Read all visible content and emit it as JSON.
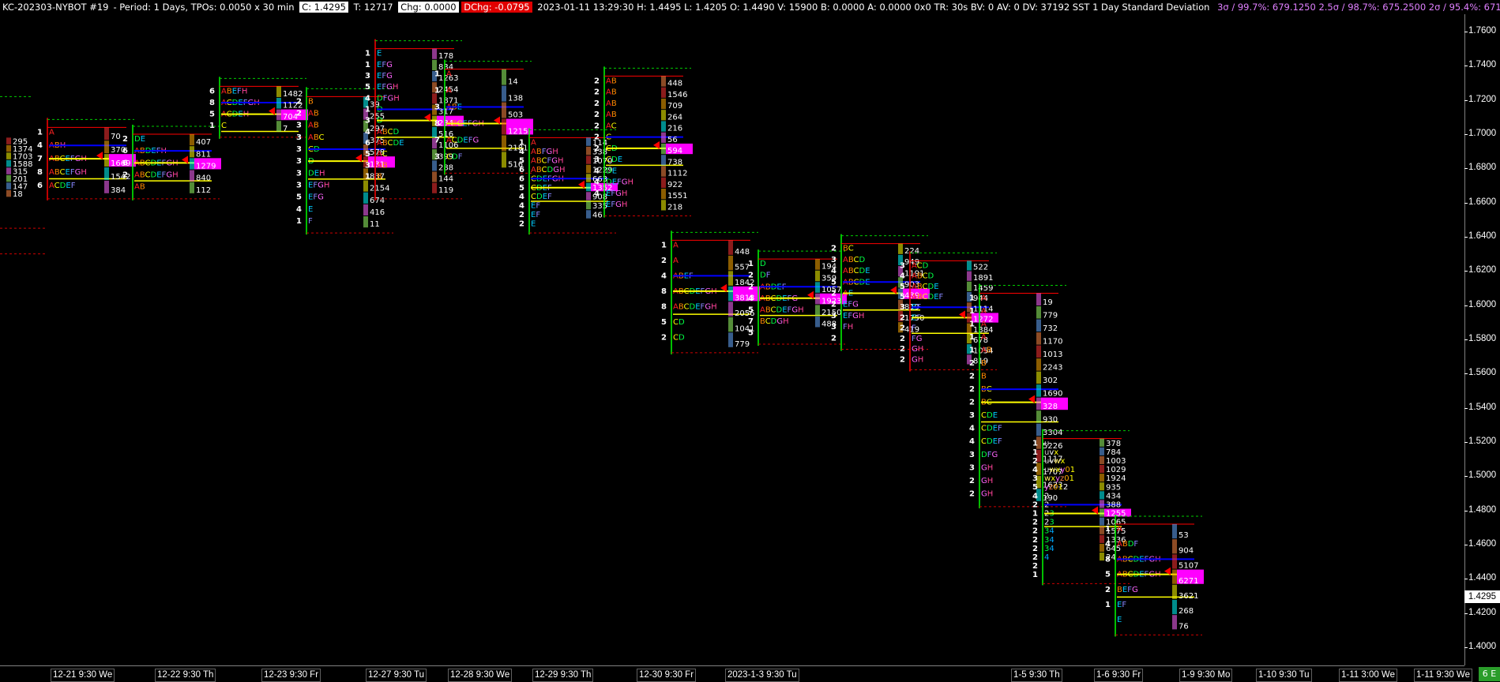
{
  "header": {
    "symbol": "KC-202303-NYBOT  #19",
    "period": "- Period: 1 Days, TPOs: 0.0050 x 30 min",
    "close": "C: 1.4295",
    "ticks": "T: 12717",
    "change": "Chg: 0.0000",
    "dchange": "DChg: -0.0795",
    "stats": "2023-01-11 13:29:30 H: 1.4495 L: 1.4205 O: 1.4490 V: 15900 B: 0.0000 A: 0.0000 0x0 TR: 30s BV: 0 AV: 0 DV: 37192 SST 1 Day Standard Deviation",
    "sd": "3σ / 99.7%: 679.1250  2.5σ / 98.7%: 675.2500  2σ / 95.4%: 671.3750  1.618σ /"
  },
  "colors": {
    "background": "#000000",
    "poc": "#ffff00",
    "va_line": "#0000ff",
    "magenta": "#ff00ff",
    "up_open": "#00ff00",
    "down_close": "#ff0000",
    "range_dash": "#00cc00",
    "low_dash": "#cc0000"
  },
  "yaxis": {
    "ticks": [
      "1.7600",
      "1.7400",
      "1.7200",
      "1.7000",
      "1.6800",
      "1.6600",
      "1.6400",
      "1.6200",
      "1.6000",
      "1.5800",
      "1.5600",
      "1.5400",
      "1.5200",
      "1.5000",
      "1.4800",
      "1.4600",
      "1.4400",
      "1.4200",
      "1.4000"
    ],
    "current_price": "1.4295"
  },
  "sessions": [
    {
      "date": "12-21  9:30 We",
      "high": 1.704,
      "low": 1.665,
      "up": false,
      "counts": [
        "1",
        "4",
        "7",
        "8",
        "6"
      ],
      "letters": [
        "A",
        "ABH",
        "ABCEFGH",
        "ABCEFGH",
        "ACDEF"
      ],
      "volumes": [
        "70",
        "370",
        "1669",
        "1542",
        "384"
      ],
      "volbars": [
        "295",
        "1374",
        "1703",
        "1588",
        "315",
        "201",
        "147",
        "18"
      ]
    },
    {
      "date": "12-22  9:30 Th",
      "high": 1.7,
      "low": 1.665,
      "up": true,
      "counts": [
        "2",
        "6",
        "6",
        "2"
      ],
      "letters": [
        "DE",
        "ABDEFH",
        "ABCDEFGH",
        "ABCDEFGH",
        "AB"
      ],
      "volumes": [
        "407",
        "811",
        "1279",
        "840",
        "112"
      ]
    },
    {
      "date": "12-23  9:30 Fr",
      "high": 1.728,
      "low": 1.701,
      "up": true,
      "counts": [
        "6",
        "8",
        "5",
        "1"
      ],
      "letters": [
        "ABEFH",
        "ACDEFGH",
        "ACDEH",
        "C"
      ],
      "volumes": [
        "1482",
        "1122",
        "704",
        "7"
      ]
    },
    {
      "date": "12-27  9:30 Tu",
      "high": 1.722,
      "low": 1.645,
      "up": true,
      "counts": [
        "2",
        "2",
        "3",
        "3",
        "3",
        "3",
        "3",
        "3",
        "5",
        "4",
        "1"
      ],
      "letters": [
        "B",
        "AB",
        "AB",
        "ABC",
        "CD",
        "D",
        "DEH",
        "EFGH",
        "EFG",
        "E",
        "F"
      ],
      "volumes": [
        "39",
        "255",
        "297",
        "375",
        "578",
        "131",
        "837",
        "2154",
        "674",
        "416",
        "11"
      ]
    },
    {
      "date": "12-28  9:30 We",
      "high": 1.75,
      "low": 1.665,
      "up": false,
      "counts": [
        "1",
        "1",
        "3",
        "5",
        "4",
        "1",
        "3",
        "4",
        "6",
        "5",
        "3",
        "1"
      ],
      "letters": [
        "E",
        "EFG",
        "EFG",
        "EFGH",
        "DFGH",
        "D",
        "D",
        "ABCD",
        "ABCDE",
        "AC",
        "AB",
        "B"
      ],
      "volumes": [
        "178",
        "834",
        "1263",
        "2454",
        "1871",
        "317",
        "234",
        "516",
        "1106",
        "399",
        "288",
        "144",
        "119"
      ]
    },
    {
      "date": "12-29  9:30 Th",
      "high": 1.738,
      "low": 1.68,
      "up": true,
      "counts": [
        "1",
        "1",
        "3",
        "8",
        "7",
        "3"
      ],
      "letters": [
        "A",
        "A",
        "ABE",
        "ABCEFGH",
        "ACDEFG",
        "CDF"
      ],
      "volumes": [
        "14",
        "138",
        "503",
        "1215",
        "2181",
        "516"
      ]
    },
    {
      "date": "12-30  9:30 Fr",
      "high": 1.698,
      "low": 1.645,
      "up": true,
      "counts": [
        "1",
        "4",
        "5",
        "6",
        "6",
        "5",
        "4",
        "4",
        "2",
        "2"
      ],
      "letters": [
        "A",
        "ABFGH",
        "ABCFGH",
        "ABCDGH",
        "CDEFGH",
        "CDEF",
        "CDEF",
        "EF",
        "EF",
        "E"
      ],
      "volumes": [
        "114",
        "338",
        "1070",
        "1229",
        "663",
        "1352",
        "908",
        "335",
        "46"
      ]
    },
    {
      "date": "2023-1-3  9:30 Tu",
      "high": 1.734,
      "low": 1.655,
      "up": true,
      "counts": [
        "2",
        "2",
        "2",
        "2",
        "2",
        "2",
        "2",
        "3",
        "4",
        "4",
        "4"
      ],
      "letters": [
        "AB",
        "AB",
        "AB",
        "AB",
        "AC",
        "C",
        "CD",
        "CDE",
        "DE",
        "DEFGH",
        "EFGH",
        "EFGH"
      ],
      "volumes": [
        "448",
        "1546",
        "709",
        "264",
        "216",
        "56",
        "594",
        "738",
        "1112",
        "922",
        "1551",
        "218"
      ]
    },
    {
      "date": "",
      "high": 1.638,
      "low": 1.575,
      "up": true,
      "counts": [
        "1",
        "2",
        "4",
        "8",
        "8",
        "5",
        "2"
      ],
      "letters": [
        "A",
        "A",
        "ABEF",
        "ABCDEFGH",
        "ABCDEFGH",
        "CD",
        "CD"
      ],
      "volumes": [
        "448",
        "557",
        "1842",
        "3813",
        "2056",
        "1041",
        "779"
      ]
    },
    {
      "date": "1-5  9:30 Th",
      "high": 1.627,
      "low": 1.58,
      "up": true,
      "counts": [
        "1",
        "2",
        "2",
        "4",
        "5",
        "7",
        "5"
      ],
      "letters": [
        "D",
        "DF",
        "ABDEF",
        "ABCDEFG",
        "ABCDEFGH",
        "BCDGH"
      ],
      "volumes": [
        "194",
        "359",
        "1057",
        "1923",
        "2150",
        "488"
      ]
    },
    {
      "date": "1-6  9:30 Fr",
      "high": 1.636,
      "low": 1.577,
      "up": true,
      "counts": [
        "2",
        "3",
        "4",
        "5",
        "2",
        "2",
        "3",
        "3",
        "2"
      ],
      "letters": [
        "BC",
        "ABCD",
        "ABCDE",
        "ABCDE",
        "AE",
        "EFG",
        "EFGH",
        "FH"
      ],
      "volumes": [
        "224",
        "949",
        "1191",
        "903",
        "439",
        "819",
        "1750",
        "419"
      ]
    },
    {
      "date": "1-9  9:30 Mo",
      "high": 1.626,
      "low": 1.565,
      "up": false,
      "counts": [
        "3",
        "4",
        "5",
        "5",
        "3",
        "2",
        "2",
        "2",
        "2",
        "2"
      ],
      "letters": [
        "ACD",
        "ABCD",
        "ABCDE",
        "ABCDEF",
        "EF",
        "EF",
        "F",
        "FG",
        "GH",
        "GH"
      ],
      "volumes": [
        "522",
        "1891",
        "1459",
        "944",
        "1114",
        "1272",
        "1384",
        "678",
        "1054",
        "819"
      ]
    },
    {
      "date": "1-10  9:30 Tu",
      "high": 1.607,
      "low": 1.485,
      "up": true,
      "counts": [
        "1",
        "1",
        "1",
        "1",
        "1",
        "2",
        "2",
        "2",
        "2",
        "3",
        "4",
        "4",
        "3",
        "3",
        "2",
        "2"
      ],
      "letters": [
        "A",
        "A",
        "A",
        "A",
        "AB",
        "B",
        "B",
        "BC",
        "BC",
        "CDE",
        "CDEF",
        "CDEF",
        "DFG",
        "GH",
        "GH",
        "GH"
      ],
      "volumes": [
        "19",
        "779",
        "732",
        "1170",
        "1013",
        "2243",
        "302",
        "1690",
        "328",
        "930",
        "3304",
        "5226",
        "1117",
        "1707",
        "1623",
        "190"
      ]
    },
    {
      "date": "1-11  3:00 We",
      "high": 1.522,
      "low": 1.44,
      "up": true,
      "counts": [
        "1",
        "1",
        "2",
        "4",
        "3",
        "5",
        "4",
        "2",
        "1",
        "2",
        "2",
        "2",
        "2",
        "2",
        "2",
        "1"
      ],
      "letters": [
        "u",
        "uvx",
        "uvwx",
        "uwxy01",
        "wxyz01",
        "yz012",
        "2",
        "2",
        "23",
        "23",
        "34",
        "34",
        "34",
        "4"
      ],
      "volumes": [
        "378",
        "784",
        "1003",
        "1029",
        "1924",
        "935",
        "434",
        "388",
        "1255",
        "1065",
        "1575",
        "1336",
        "645",
        "24"
      ]
    },
    {
      "date": "1-11  9:30 We",
      "high": 1.472,
      "low": 1.41,
      "up": true,
      "counts": [
        "1",
        "4",
        "8",
        "5",
        "2",
        "1"
      ],
      "letters": [
        "A",
        "ABDF",
        "ABCDEFGH",
        "ABCDEFGH",
        "BEFG",
        "EF",
        "E"
      ],
      "volumes": [
        "53",
        "904",
        "5107",
        "6271",
        "3621",
        "268",
        "76"
      ]
    }
  ],
  "corner_label": "6 E"
}
